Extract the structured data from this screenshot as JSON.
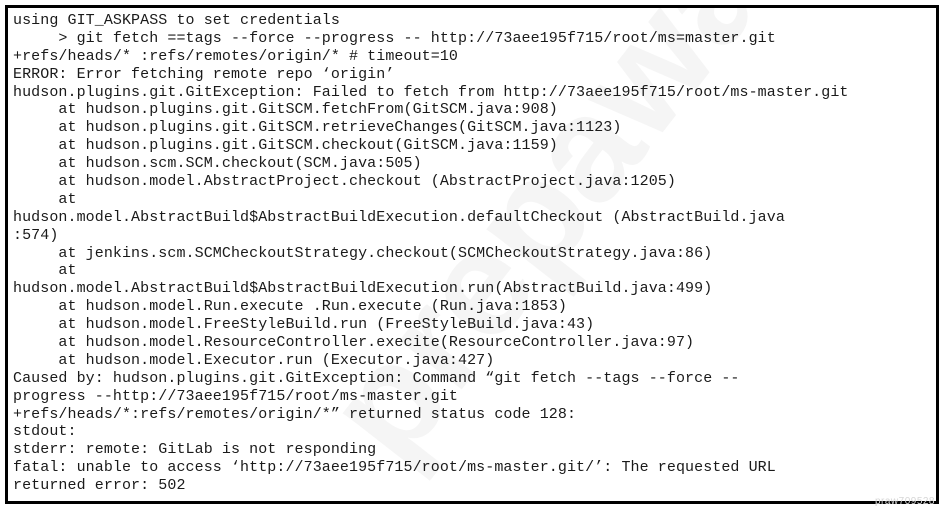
{
  "console": {
    "lines": [
      "using GIT_ASKPASS to set credentials",
      "     > git fetch ==tags --force --progress -- http://73aee195f715/root/ms=master.git",
      "+refs/heads/* :refs/remotes/origin/* # timeout=10",
      "ERROR: Error fetching remote repo ‘origin’",
      "hudson.plugins.git.GitException: Failed to fetch from http://73aee195f715/root/ms-master.git",
      "     at hudson.plugins.git.GitSCM.fetchFrom(GitSCM.java:908)",
      "     at hudson.plugins.git.GitSCM.retrieveChanges(GitSCM.java:1123)",
      "     at hudson.plugins.git.GitSCM.checkout(GitSCM.java:1159)",
      "     at hudson.scm.SCM.checkout(SCM.java:505)",
      "     at hudson.model.AbstractProject.checkout (AbstractProject.java:1205)",
      "     at",
      "hudson.model.AbstractBuild$AbstractBuildExecution.defaultCheckout (AbstractBuild.java",
      ":574)",
      "     at jenkins.scm.SCMCheckoutStrategy.checkout(SCMCheckoutStrategy.java:86)",
      "     at",
      "hudson.model.AbstractBuild$AbstractBuildExecution.run(AbstractBuild.java:499)",
      "     at hudson.model.Run.execute .Run.execute (Run.java:1853)",
      "     at hudson.model.FreeStyleBuild.run (FreeStyleBuild.java:43)",
      "     at hudson.model.ResourceController.execite(ResourceController.java:97)",
      "     at hudson.model.Executor.run (Executor.java:427)",
      "Caused by: hudson.plugins.git.GitException: Command “git fetch --tags --force --",
      "progress --http://73aee195f715/root/ms-master.git",
      "+refs/heads/*:refs/remotes/origin/*” returned status code 128:",
      "stdout:",
      "stderr: remote: GitLab is not responding",
      "fatal: unable to access ‘http://73aee195f715/root/ms-master.git/’: The requested URL",
      "returned error: 502"
    ]
  },
  "watermark": {
    "text": "prepaway"
  },
  "corner_mark": {
    "text": "praw709528"
  },
  "colors": {
    "text": "#1a1a1a",
    "border": "#000000",
    "background": "#ffffff"
  }
}
